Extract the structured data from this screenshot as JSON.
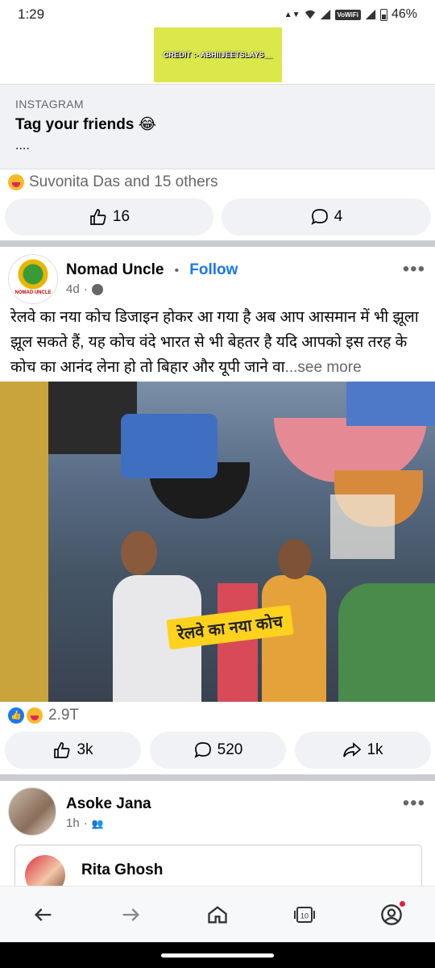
{
  "status_bar": {
    "time": "1:29",
    "network_badge": "VoWiFi",
    "battery": "46%"
  },
  "credit_banner": {
    "text": "CREDIT :- ABHIIJEETSLAYS__",
    "color": "#dce84a"
  },
  "link_preview": {
    "source": "INSTAGRAM",
    "title": "Tag your friends 😂",
    "dots": "...."
  },
  "post1_footer": {
    "reaction_text": "Suvonita Das and 15 others",
    "like_count": "16",
    "comment_count": "4"
  },
  "post2": {
    "author": "Nomad Uncle",
    "separator": "•",
    "follow_label": "Follow",
    "time": "4d",
    "avatar_label": "NOMAD UNCLE",
    "text": "रेलवे का नया कोच डिजाइन होकर आ गया है अब आप आसमान में भी झूला झूल सकते हैं, यह कोच वंदे भारत से भी बेहतर है यदि आपको इस तरह के कोच का आनंद लेना हो तो बिहार और यूपी जाने वा",
    "see_more": "...see more",
    "image_caption": "रेलवे का नया कोच",
    "reaction_count": "2.9T",
    "like_count": "3k",
    "comment_count": "520",
    "share_count": "1k"
  },
  "post3": {
    "author": "Asoke Jana",
    "time": "1h"
  },
  "shared_post": {
    "author": "Rita Ghosh"
  },
  "bottom_nav": {
    "items": [
      {
        "icon": "back-arrow-icon"
      },
      {
        "icon": "forward-arrow-icon"
      },
      {
        "icon": "home-icon"
      },
      {
        "icon": "tabs-icon",
        "badge": "10"
      },
      {
        "icon": "account-icon"
      }
    ]
  },
  "colors": {
    "accent": "#1877f2",
    "muted": "#65676b",
    "pill_bg": "#f0f2f5"
  }
}
